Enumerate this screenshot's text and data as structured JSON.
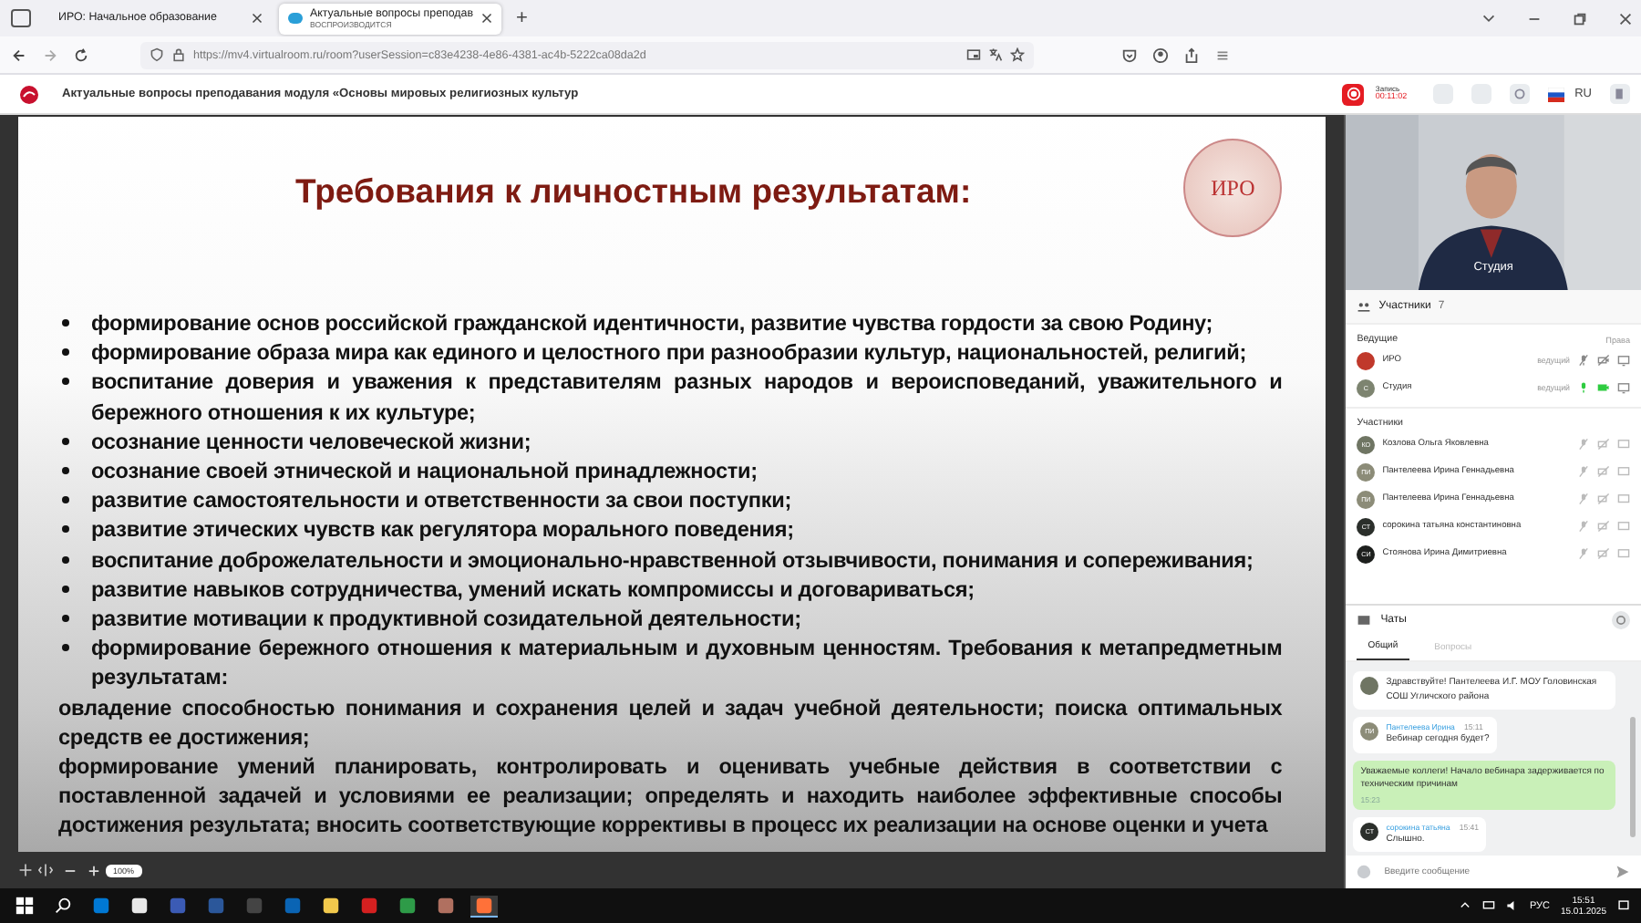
{
  "browser": {
    "tabs": [
      {
        "title": "ИРО: Начальное образование",
        "selected": false
      },
      {
        "title": "Актуальные вопросы преподав",
        "subtitle": "ВОСПРОИЗВОДИТСЯ",
        "selected": true
      }
    ],
    "new_tab": "+",
    "url": "https://mv4.virtualroom.ru/room?userSession=c83e4238-4e86-4381-ac4b-5222ca08da2d"
  },
  "header": {
    "title": "Актуальные вопросы преподавания модуля «Основы мировых религиозных культур",
    "record_label": "Запись",
    "record_time": "00:11:02",
    "language": "RU"
  },
  "slide": {
    "title": "Требования к личностным результатам:",
    "logo": "ИРО",
    "items": [
      {
        "kind": "bullet",
        "text": "формирование основ российской гражданской идентичности, развитие чувства гордости за свою Родину;"
      },
      {
        "kind": "bullet",
        "text": "формирование образа мира как единого и целостного при разнообразии культур, национальностей, религий;"
      },
      {
        "kind": "bullet",
        "text": "воспитание доверия и уважения к представителям разных народов и вероисповеданий, уважительного и бережного отношения к их культуре;"
      },
      {
        "kind": "bullet",
        "text": "осознание ценности человеческой жизни;"
      },
      {
        "kind": "bullet",
        "text": "осознание своей этнической и национальной принадлежности;"
      },
      {
        "kind": "bullet",
        "text": "развитие самостоятельности и ответственности за свои поступки;"
      },
      {
        "kind": "bullet",
        "text": "развитие этических чувств как регулятора морального поведения;"
      },
      {
        "kind": "bullet",
        "text": "воспитание доброжелательности и эмоционально-нравственной отзывчивости, понимания и сопереживания;"
      },
      {
        "kind": "bullet",
        "text": "развитие навыков сотрудничества, умений искать компромиссы и договариваться;"
      },
      {
        "kind": "bullet",
        "text": "развитие мотивации к продуктивной созидательной деятельности;"
      },
      {
        "kind": "bullet",
        "text": "формирование бережного отношения к материальным и духовным ценностям. Требования к метапредметным результатам:"
      },
      {
        "kind": "plain",
        "text": "овладение способностью понимания и сохранения целей и задач учебной деятельности; поиска оптимальных средств ее достижения;"
      },
      {
        "kind": "plain",
        "text": "формирование умений планировать, контролировать и оценивать учебные действия в соответствии с поставленной задачей и условиями ее реализации; определять и находить наиболее эффективные способы достижения результата; вносить соответствующие коррективы в процесс их реализации на основе оценки и учета"
      }
    ],
    "zoom": "100%"
  },
  "video": {
    "label": "Студия"
  },
  "participants": {
    "title": "Участники",
    "count": "7",
    "hosts_title": "Ведущие",
    "rights": "Права",
    "hosts": [
      {
        "name": "ИРО",
        "role": "ведущий",
        "mic_on": false,
        "cam_on": false,
        "color": "#c0392b"
      },
      {
        "initials": "С",
        "name": "Студия",
        "role": "ведущий",
        "mic_on": true,
        "cam_on": true,
        "color": "#7d8470"
      }
    ],
    "members_title": "Участники",
    "members": [
      {
        "initials": "КО",
        "name": "Козлова Ольга Яковлевна",
        "color": "#6f7563"
      },
      {
        "initials": "ПИ",
        "name": "Пантелеева Ирина Геннадьевна",
        "color": "#8c8c78"
      },
      {
        "initials": "ПИ",
        "name": "Пантелеева Ирина Геннадьевна",
        "color": "#8c8c78"
      },
      {
        "initials": "СТ",
        "name": "сорокина татьяна константиновна",
        "color": "#2b2f2b"
      },
      {
        "initials": "СИ",
        "name": "Стоянова Ирина Димитриевна",
        "color": "#1d1f1d"
      }
    ]
  },
  "chat": {
    "title": "Чаты",
    "tabs": [
      {
        "label": "Общий",
        "selected": true
      },
      {
        "label": "Вопросы",
        "selected": false
      }
    ],
    "messages": [
      {
        "kind": "other",
        "text": "Здравствуйте! Пантелеева И.Г. МОУ Головинская СОШ Угличского района",
        "color": "#6f7563"
      },
      {
        "kind": "other",
        "initials": "ПИ",
        "author": "Пантелеева Ирина",
        "time": "15:11",
        "text": "Вебинар сегодня будет?",
        "color": "#8c8c78"
      },
      {
        "kind": "own",
        "time": "15:23",
        "text": "Уважаемые коллеги! Начало вебинара задерживается по техническим причинам",
        "color": "#c9f0b8"
      },
      {
        "kind": "other",
        "initials": "СТ",
        "author": "сорокина татьяна",
        "time": "15:41",
        "text": "Слышно.",
        "color": "#2b2f2b"
      }
    ],
    "placeholder": "Введите сообщение"
  },
  "taskbar": {
    "language": "РУС",
    "time": "15:51",
    "date": "15.01.2025"
  }
}
